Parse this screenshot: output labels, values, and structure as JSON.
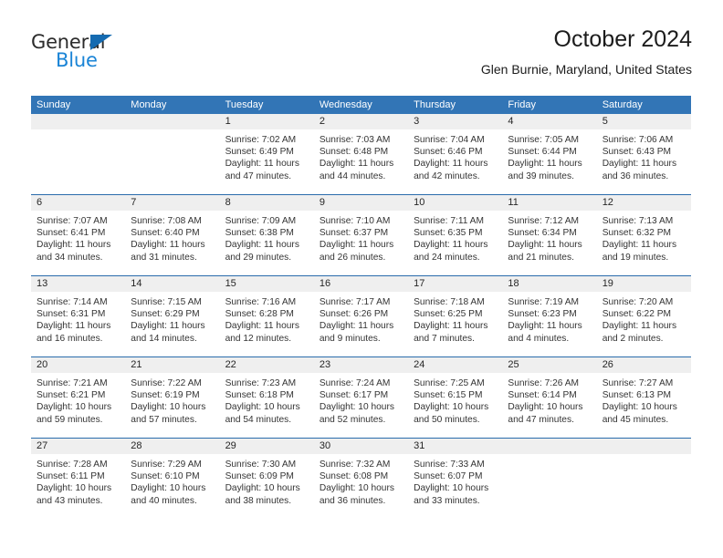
{
  "brand": {
    "word_top": "General",
    "word_bottom": "Blue",
    "triangle_color": "#156bb1",
    "blue_text_color": "#1a84d6"
  },
  "header": {
    "title": "October 2024",
    "subtitle": "Glen Burnie, Maryland, United States"
  },
  "theme": {
    "header_blue": "#3275b6",
    "row_rule_blue": "#2a6cac",
    "day_band_gray": "#efefef"
  },
  "weekdays": [
    "Sunday",
    "Monday",
    "Tuesday",
    "Wednesday",
    "Thursday",
    "Friday",
    "Saturday"
  ],
  "weeks": [
    [
      {
        "day": "",
        "lines": []
      },
      {
        "day": "",
        "lines": []
      },
      {
        "day": "1",
        "lines": [
          "Sunrise: 7:02 AM",
          "Sunset: 6:49 PM",
          "Daylight: 11 hours",
          "and 47 minutes."
        ]
      },
      {
        "day": "2",
        "lines": [
          "Sunrise: 7:03 AM",
          "Sunset: 6:48 PM",
          "Daylight: 11 hours",
          "and 44 minutes."
        ]
      },
      {
        "day": "3",
        "lines": [
          "Sunrise: 7:04 AM",
          "Sunset: 6:46 PM",
          "Daylight: 11 hours",
          "and 42 minutes."
        ]
      },
      {
        "day": "4",
        "lines": [
          "Sunrise: 7:05 AM",
          "Sunset: 6:44 PM",
          "Daylight: 11 hours",
          "and 39 minutes."
        ]
      },
      {
        "day": "5",
        "lines": [
          "Sunrise: 7:06 AM",
          "Sunset: 6:43 PM",
          "Daylight: 11 hours",
          "and 36 minutes."
        ]
      }
    ],
    [
      {
        "day": "6",
        "lines": [
          "Sunrise: 7:07 AM",
          "Sunset: 6:41 PM",
          "Daylight: 11 hours",
          "and 34 minutes."
        ]
      },
      {
        "day": "7",
        "lines": [
          "Sunrise: 7:08 AM",
          "Sunset: 6:40 PM",
          "Daylight: 11 hours",
          "and 31 minutes."
        ]
      },
      {
        "day": "8",
        "lines": [
          "Sunrise: 7:09 AM",
          "Sunset: 6:38 PM",
          "Daylight: 11 hours",
          "and 29 minutes."
        ]
      },
      {
        "day": "9",
        "lines": [
          "Sunrise: 7:10 AM",
          "Sunset: 6:37 PM",
          "Daylight: 11 hours",
          "and 26 minutes."
        ]
      },
      {
        "day": "10",
        "lines": [
          "Sunrise: 7:11 AM",
          "Sunset: 6:35 PM",
          "Daylight: 11 hours",
          "and 24 minutes."
        ]
      },
      {
        "day": "11",
        "lines": [
          "Sunrise: 7:12 AM",
          "Sunset: 6:34 PM",
          "Daylight: 11 hours",
          "and 21 minutes."
        ]
      },
      {
        "day": "12",
        "lines": [
          "Sunrise: 7:13 AM",
          "Sunset: 6:32 PM",
          "Daylight: 11 hours",
          "and 19 minutes."
        ]
      }
    ],
    [
      {
        "day": "13",
        "lines": [
          "Sunrise: 7:14 AM",
          "Sunset: 6:31 PM",
          "Daylight: 11 hours",
          "and 16 minutes."
        ]
      },
      {
        "day": "14",
        "lines": [
          "Sunrise: 7:15 AM",
          "Sunset: 6:29 PM",
          "Daylight: 11 hours",
          "and 14 minutes."
        ]
      },
      {
        "day": "15",
        "lines": [
          "Sunrise: 7:16 AM",
          "Sunset: 6:28 PM",
          "Daylight: 11 hours",
          "and 12 minutes."
        ]
      },
      {
        "day": "16",
        "lines": [
          "Sunrise: 7:17 AM",
          "Sunset: 6:26 PM",
          "Daylight: 11 hours",
          "and 9 minutes."
        ]
      },
      {
        "day": "17",
        "lines": [
          "Sunrise: 7:18 AM",
          "Sunset: 6:25 PM",
          "Daylight: 11 hours",
          "and 7 minutes."
        ]
      },
      {
        "day": "18",
        "lines": [
          "Sunrise: 7:19 AM",
          "Sunset: 6:23 PM",
          "Daylight: 11 hours",
          "and 4 minutes."
        ]
      },
      {
        "day": "19",
        "lines": [
          "Sunrise: 7:20 AM",
          "Sunset: 6:22 PM",
          "Daylight: 11 hours",
          "and 2 minutes."
        ]
      }
    ],
    [
      {
        "day": "20",
        "lines": [
          "Sunrise: 7:21 AM",
          "Sunset: 6:21 PM",
          "Daylight: 10 hours",
          "and 59 minutes."
        ]
      },
      {
        "day": "21",
        "lines": [
          "Sunrise: 7:22 AM",
          "Sunset: 6:19 PM",
          "Daylight: 10 hours",
          "and 57 minutes."
        ]
      },
      {
        "day": "22",
        "lines": [
          "Sunrise: 7:23 AM",
          "Sunset: 6:18 PM",
          "Daylight: 10 hours",
          "and 54 minutes."
        ]
      },
      {
        "day": "23",
        "lines": [
          "Sunrise: 7:24 AM",
          "Sunset: 6:17 PM",
          "Daylight: 10 hours",
          "and 52 minutes."
        ]
      },
      {
        "day": "24",
        "lines": [
          "Sunrise: 7:25 AM",
          "Sunset: 6:15 PM",
          "Daylight: 10 hours",
          "and 50 minutes."
        ]
      },
      {
        "day": "25",
        "lines": [
          "Sunrise: 7:26 AM",
          "Sunset: 6:14 PM",
          "Daylight: 10 hours",
          "and 47 minutes."
        ]
      },
      {
        "day": "26",
        "lines": [
          "Sunrise: 7:27 AM",
          "Sunset: 6:13 PM",
          "Daylight: 10 hours",
          "and 45 minutes."
        ]
      }
    ],
    [
      {
        "day": "27",
        "lines": [
          "Sunrise: 7:28 AM",
          "Sunset: 6:11 PM",
          "Daylight: 10 hours",
          "and 43 minutes."
        ]
      },
      {
        "day": "28",
        "lines": [
          "Sunrise: 7:29 AM",
          "Sunset: 6:10 PM",
          "Daylight: 10 hours",
          "and 40 minutes."
        ]
      },
      {
        "day": "29",
        "lines": [
          "Sunrise: 7:30 AM",
          "Sunset: 6:09 PM",
          "Daylight: 10 hours",
          "and 38 minutes."
        ]
      },
      {
        "day": "30",
        "lines": [
          "Sunrise: 7:32 AM",
          "Sunset: 6:08 PM",
          "Daylight: 10 hours",
          "and 36 minutes."
        ]
      },
      {
        "day": "31",
        "lines": [
          "Sunrise: 7:33 AM",
          "Sunset: 6:07 PM",
          "Daylight: 10 hours",
          "and 33 minutes."
        ]
      },
      {
        "day": "",
        "lines": []
      },
      {
        "day": "",
        "lines": []
      }
    ]
  ]
}
